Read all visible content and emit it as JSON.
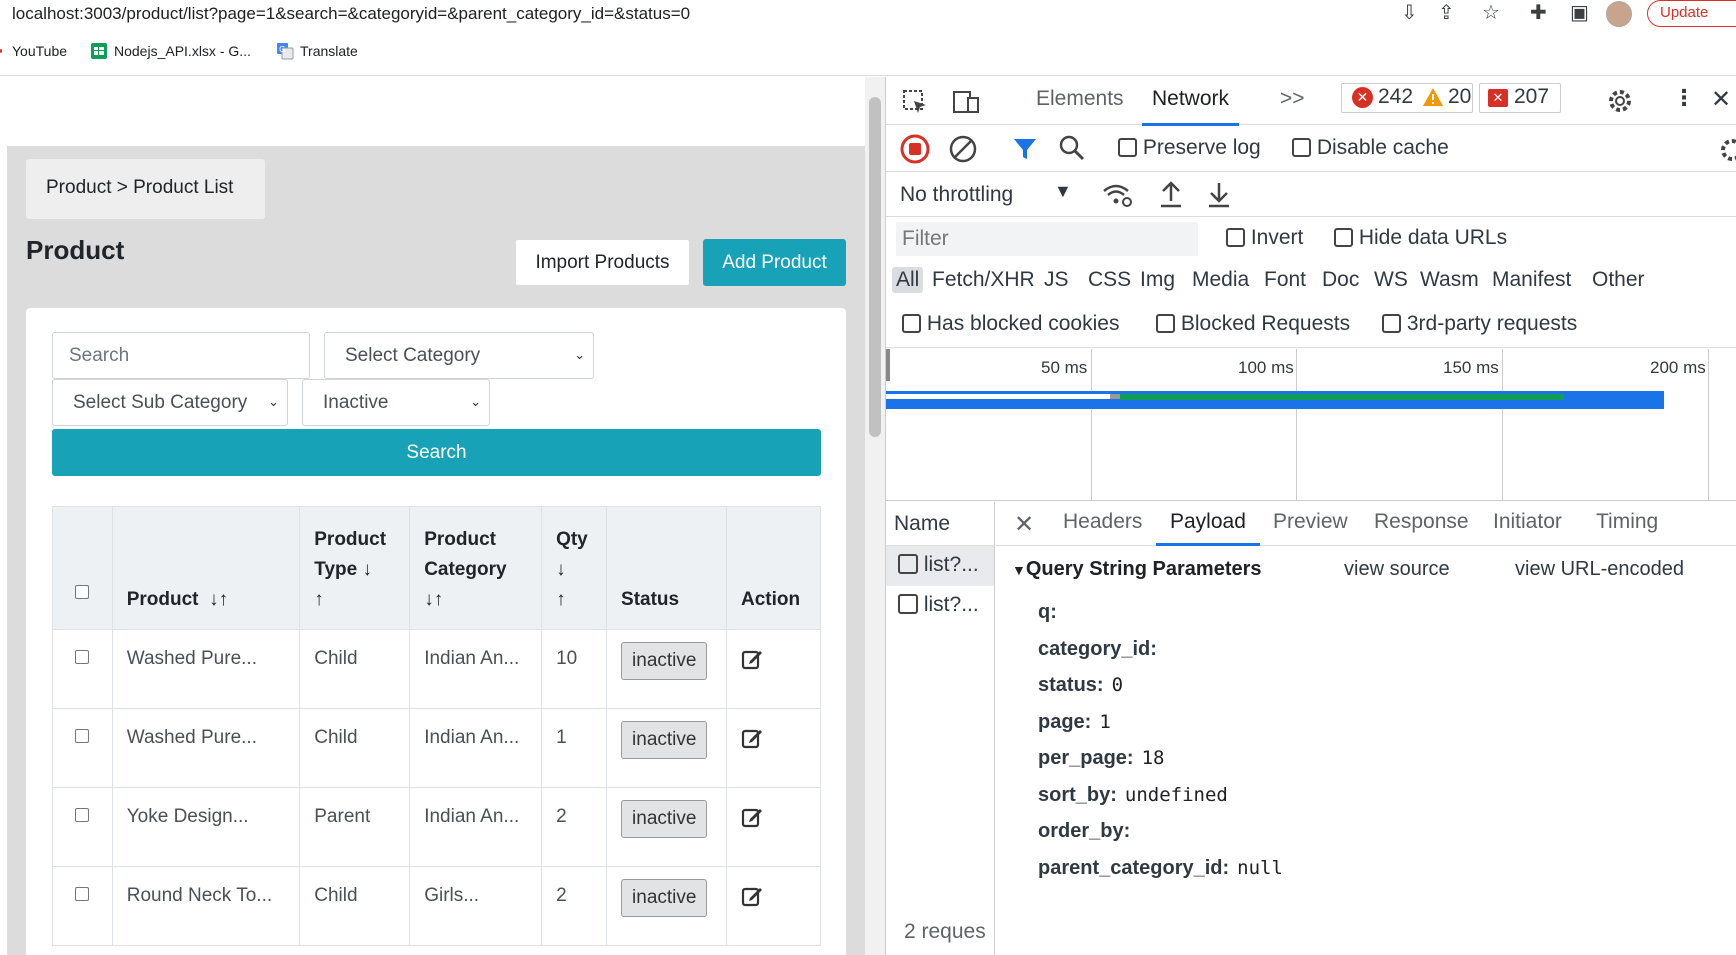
{
  "browser": {
    "url": "localhost:3003/product/list?page=1&search=&categoryid=&parent_category_id=&status=0",
    "update_label": "Update",
    "bookmarks": [
      {
        "label": "YouTube",
        "icon": "youtube-icon"
      },
      {
        "label": "Nodejs_API.xlsx - G...",
        "icon": "sheets-icon"
      },
      {
        "label": "Translate",
        "icon": "translate-icon"
      }
    ]
  },
  "app": {
    "breadcrumb": "Product > Product List",
    "title": "Product",
    "import_label": "Import Products",
    "add_label": "Add Product",
    "filters": {
      "search_placeholder": "Search",
      "category": "Select Category",
      "sub_category": "Select Sub Category",
      "status": "Inactive",
      "search_button": "Search"
    },
    "table": {
      "headers": {
        "product": "Product",
        "product_sort": "↓↑",
        "type_l1": "Product",
        "type_l2": "Type",
        "type_sort1": "↓",
        "type_sort2": "↑",
        "cat_l1": "Product",
        "cat_l2": "Category",
        "cat_sort": "↓↑",
        "qty": "Qty",
        "qty_sort1": "↓",
        "qty_sort2": "↑",
        "status": "Status",
        "action": "Action"
      },
      "rows": [
        {
          "product": "Washed Pure...",
          "type": "Child",
          "category": "Indian An...",
          "qty": "10",
          "status": "inactive"
        },
        {
          "product": "Washed Pure...",
          "type": "Child",
          "category": "Indian An...",
          "qty": "1",
          "status": "inactive"
        },
        {
          "product": "Yoke Design...",
          "type": "Parent",
          "category": "Indian An...",
          "qty": "2",
          "status": "inactive"
        },
        {
          "product": "Round Neck To...",
          "type": "Child",
          "category": "Girls...",
          "qty": "2",
          "status": "inactive"
        }
      ]
    }
  },
  "devtools": {
    "tabs": {
      "elements": "Elements",
      "network": "Network",
      "more": ">>"
    },
    "counts": {
      "errors": "242",
      "warnings": "20",
      "issues": "207"
    },
    "preserve_log": "Preserve log",
    "disable_cache": "Disable cache",
    "throttling": "No throttling",
    "filter_placeholder": "Filter",
    "invert": "Invert",
    "hide_data_urls": "Hide data URLs",
    "type_filters": [
      "All",
      "Fetch/XHR",
      "JS",
      "CSS",
      "Img",
      "Media",
      "Font",
      "Doc",
      "WS",
      "Wasm",
      "Manifest",
      "Other"
    ],
    "has_blocked_cookies": "Has blocked cookies",
    "blocked_requests": "Blocked Requests",
    "third_party": "3rd-party requests",
    "timeline_ticks": [
      "50 ms",
      "100 ms",
      "150 ms",
      "200 ms"
    ],
    "name_header": "Name",
    "requests": [
      "list?...",
      "list?..."
    ],
    "request_count": "2 reques",
    "detail_tabs": [
      "Headers",
      "Payload",
      "Preview",
      "Response",
      "Initiator",
      "Timing"
    ],
    "active_detail_tab": "Payload",
    "section_title": "Query String Parameters",
    "view_source": "view source",
    "view_url_encoded": "view URL-encoded",
    "params": [
      {
        "key": "q:",
        "value": ""
      },
      {
        "key": "category_id:",
        "value": ""
      },
      {
        "key": "status:",
        "value": "0"
      },
      {
        "key": "page:",
        "value": "1"
      },
      {
        "key": "per_page:",
        "value": "18"
      },
      {
        "key": "sort_by:",
        "value": "undefined"
      },
      {
        "key": "order_by:",
        "value": ""
      },
      {
        "key": "parent_category_id:",
        "value": "null"
      }
    ]
  },
  "colors": {
    "accent": "#17a2b8",
    "devtools_blue": "#1a73e8",
    "error_red": "#d93025",
    "warning": "#f29900"
  }
}
